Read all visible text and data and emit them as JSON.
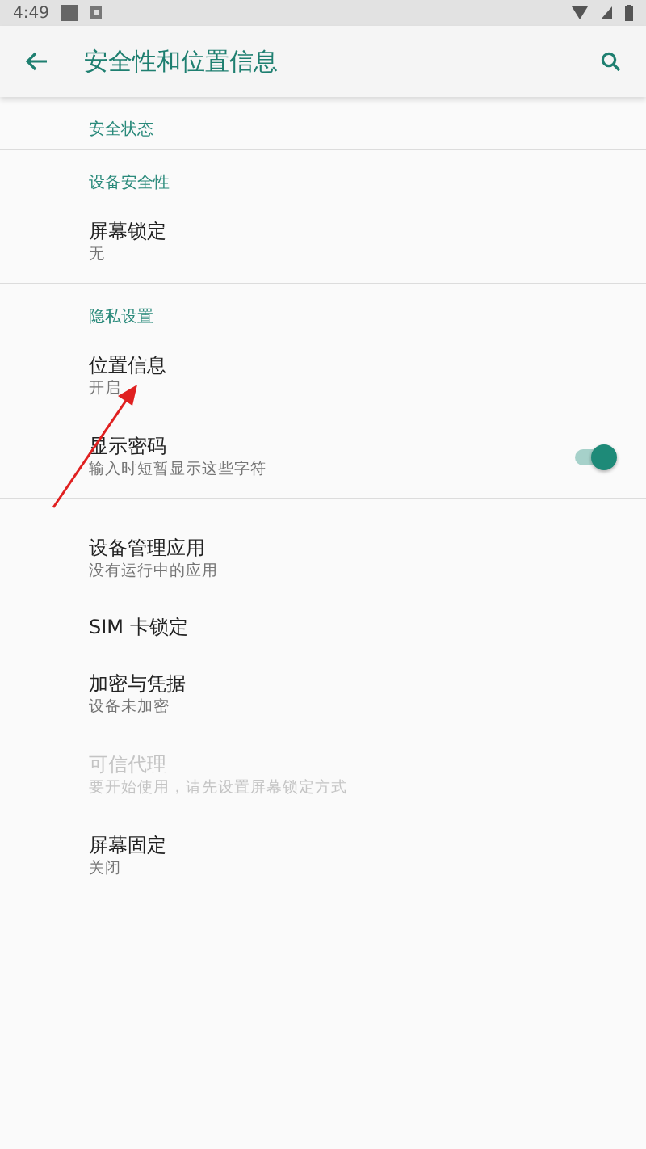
{
  "status_bar": {
    "time": "4:49"
  },
  "toolbar": {
    "title": "安全性和位置信息"
  },
  "groups": [
    {
      "header": "安全状态"
    },
    {
      "header": "设备安全性",
      "items": [
        {
          "kind": "text",
          "title": "屏幕锁定",
          "summary": "无",
          "disabled": false
        }
      ]
    },
    {
      "header": "隐私设置",
      "items": [
        {
          "kind": "text",
          "title": "位置信息",
          "summary": "开启",
          "disabled": false
        },
        {
          "kind": "switch",
          "title": "显示密码",
          "summary": "输入时短暂显示这些字符",
          "disabled": false,
          "on": true
        }
      ]
    },
    {
      "items": [
        {
          "kind": "text",
          "title": "设备管理应用",
          "summary": "没有运行中的应用",
          "disabled": false
        },
        {
          "kind": "text",
          "title": "SIM 卡锁定",
          "disabled": false
        },
        {
          "kind": "text",
          "title": "加密与凭据",
          "summary": "设备未加密",
          "disabled": false
        },
        {
          "kind": "text",
          "title": "可信代理",
          "summary": "要开始使用，请先设置屏幕锁定方式",
          "disabled": true
        },
        {
          "kind": "text",
          "title": "屏幕固定",
          "summary": "关闭",
          "disabled": false
        }
      ]
    }
  ],
  "annotation_arrow": true
}
